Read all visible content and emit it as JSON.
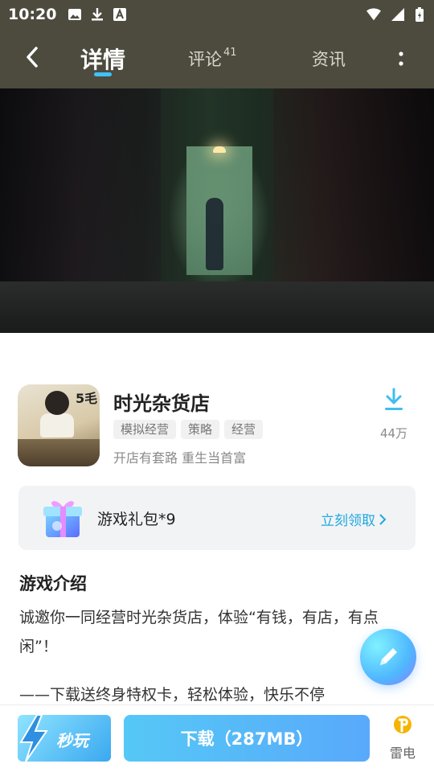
{
  "status_bar": {
    "time": "10:20"
  },
  "nav": {
    "tabs": [
      {
        "label": "详情",
        "active": true
      },
      {
        "label": "评论",
        "badge": "41"
      },
      {
        "label": "资讯"
      }
    ]
  },
  "hero": {
    "slide_count": 6,
    "active_slide": 1
  },
  "app": {
    "icon_text": "5毛",
    "name": "时光杂货店",
    "tags": [
      "模拟经营",
      "策略",
      "经营"
    ],
    "slogan": "开店有套路 重生当首富",
    "download_count": "44万"
  },
  "gift": {
    "label": "游戏礼包*9",
    "action": "立刻领取"
  },
  "intro": {
    "title": "游戏介绍",
    "paragraph1": "诚邀你一同经营时光杂货店，体验“有钱，有店，有点闲”！",
    "paragraph2": "——下载送终身特权卡，轻松体验，快乐不停"
  },
  "bottom": {
    "quick_play_label": "秒玩",
    "download_label": "下载（287MB）",
    "leidian_label": "雷电"
  },
  "colors": {
    "accent": "#3fc2ff",
    "link": "#1fa8e2",
    "header_bg": "#4c4b3e"
  }
}
